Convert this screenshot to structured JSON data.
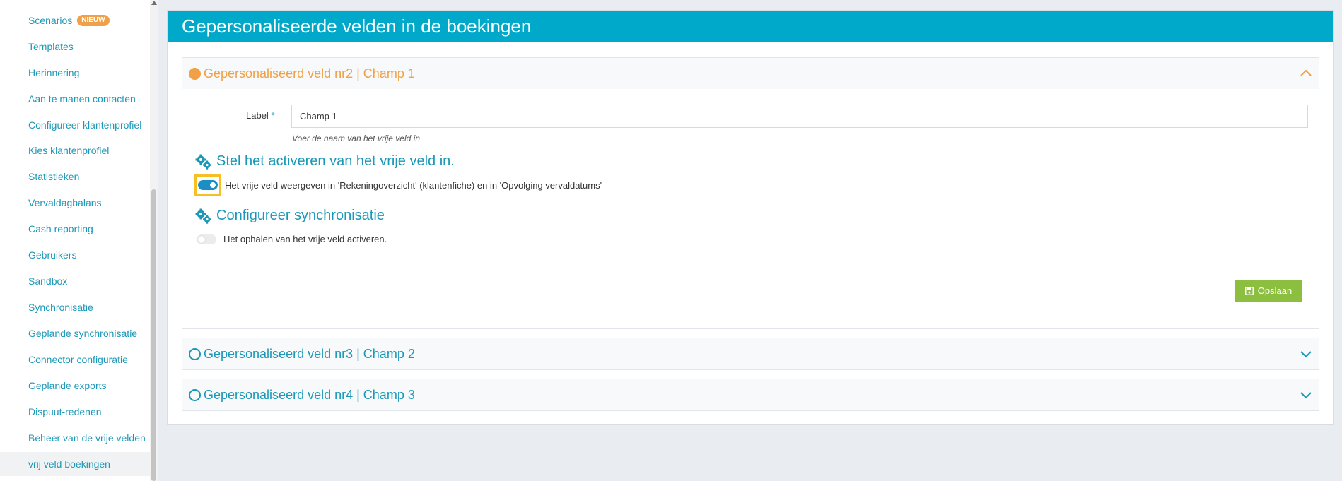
{
  "sidebar": {
    "items": [
      {
        "label": "Scenarios",
        "badge": "NIEUW"
      },
      {
        "label": "Templates"
      },
      {
        "label": "Herinnering"
      },
      {
        "label": "Aan te manen contacten"
      },
      {
        "label": "Configureer klantenprofiel"
      },
      {
        "label": "Kies klantenprofiel"
      },
      {
        "label": "Statistieken"
      },
      {
        "label": "Vervaldagbalans"
      },
      {
        "label": "Cash reporting"
      },
      {
        "label": "Gebruikers"
      },
      {
        "label": "Sandbox"
      },
      {
        "label": "Synchronisatie"
      },
      {
        "label": "Geplande synchronisatie"
      },
      {
        "label": "Connector configuratie"
      },
      {
        "label": "Geplande exports"
      },
      {
        "label": "Dispuut-redenen"
      },
      {
        "label": "Beheer van de vrije velden"
      },
      {
        "label": "vrij veld boekingen",
        "active": true
      }
    ]
  },
  "main": {
    "title": "Gepersonaliseerde velden in de boekingen",
    "accordions": [
      {
        "title": "Gepersonaliseerd veld nr2 | Champ 1",
        "expanded": true
      },
      {
        "title": "Gepersonaliseerd veld nr3 | Champ 2",
        "expanded": false
      },
      {
        "title": "Gepersonaliseerd veld nr4 | Champ 3",
        "expanded": false
      }
    ],
    "form": {
      "label_text": "Label",
      "required_mark": "*",
      "label_value": "Champ 1",
      "label_help": "Voer de naam van het vrije veld in",
      "section_activation": "Stel het activeren van het vrije veld in.",
      "toggle_display_label": "Het vrije veld weergeven in 'Rekeningoverzicht' (klantenfiche) en in 'Opvolging vervaldatums'",
      "toggle_display_on": true,
      "section_sync": "Configureer synchronisatie",
      "toggle_fetch_label": "Het ophalen van het vrije veld activeren.",
      "toggle_fetch_on": false,
      "save_label": "Opslaan"
    }
  },
  "colors": {
    "accent": "#00a9c9",
    "link": "#1b98b8",
    "warning": "#f0a046",
    "save": "#8cbf3f",
    "highlight": "#f6c024"
  },
  "icons": {
    "gears": "gears-icon",
    "save": "floppy-icon",
    "chevron_up": "chevron-up-icon",
    "chevron_down": "chevron-down-icon"
  }
}
